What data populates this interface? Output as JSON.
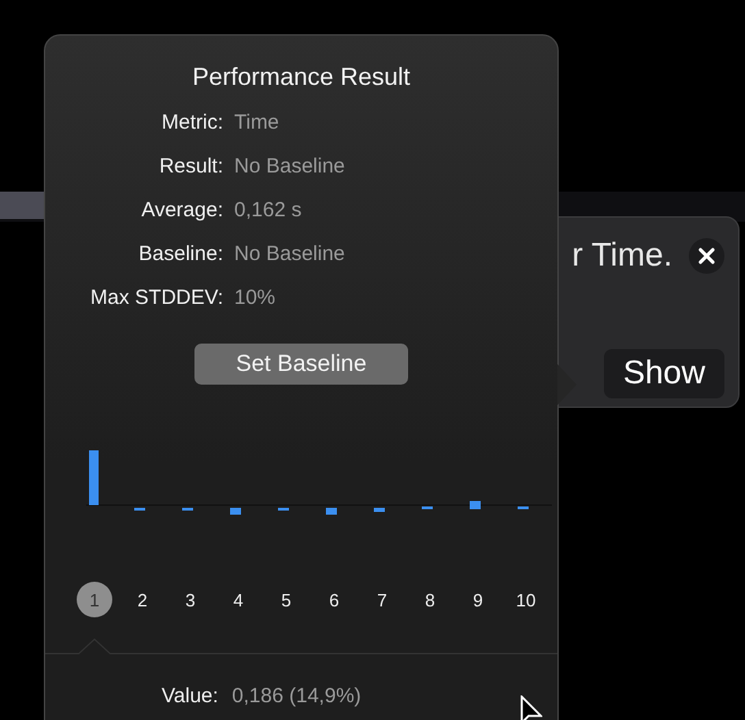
{
  "notification": {
    "text": "r Time.",
    "button": "Show"
  },
  "popover": {
    "title": "Performance Result",
    "fields": [
      {
        "label": "Metric:",
        "value": "Time"
      },
      {
        "label": "Result:",
        "value": "No Baseline"
      },
      {
        "label": "Average:",
        "value": "0,162 s"
      },
      {
        "label": "Baseline:",
        "value": "No Baseline"
      },
      {
        "label": "Max STDDEV:",
        "value": "10%"
      }
    ],
    "button": "Set Baseline",
    "iterations": [
      {
        "label": "1",
        "selected": true
      },
      {
        "label": "2",
        "selected": false
      },
      {
        "label": "3",
        "selected": false
      },
      {
        "label": "4",
        "selected": false
      },
      {
        "label": "5",
        "selected": false
      },
      {
        "label": "6",
        "selected": false
      },
      {
        "label": "7",
        "selected": false
      },
      {
        "label": "8",
        "selected": false
      },
      {
        "label": "9",
        "selected": false
      },
      {
        "label": "10",
        "selected": false
      }
    ],
    "value": {
      "label": "Value:",
      "value": "0,186 (14,9%)"
    }
  }
}
